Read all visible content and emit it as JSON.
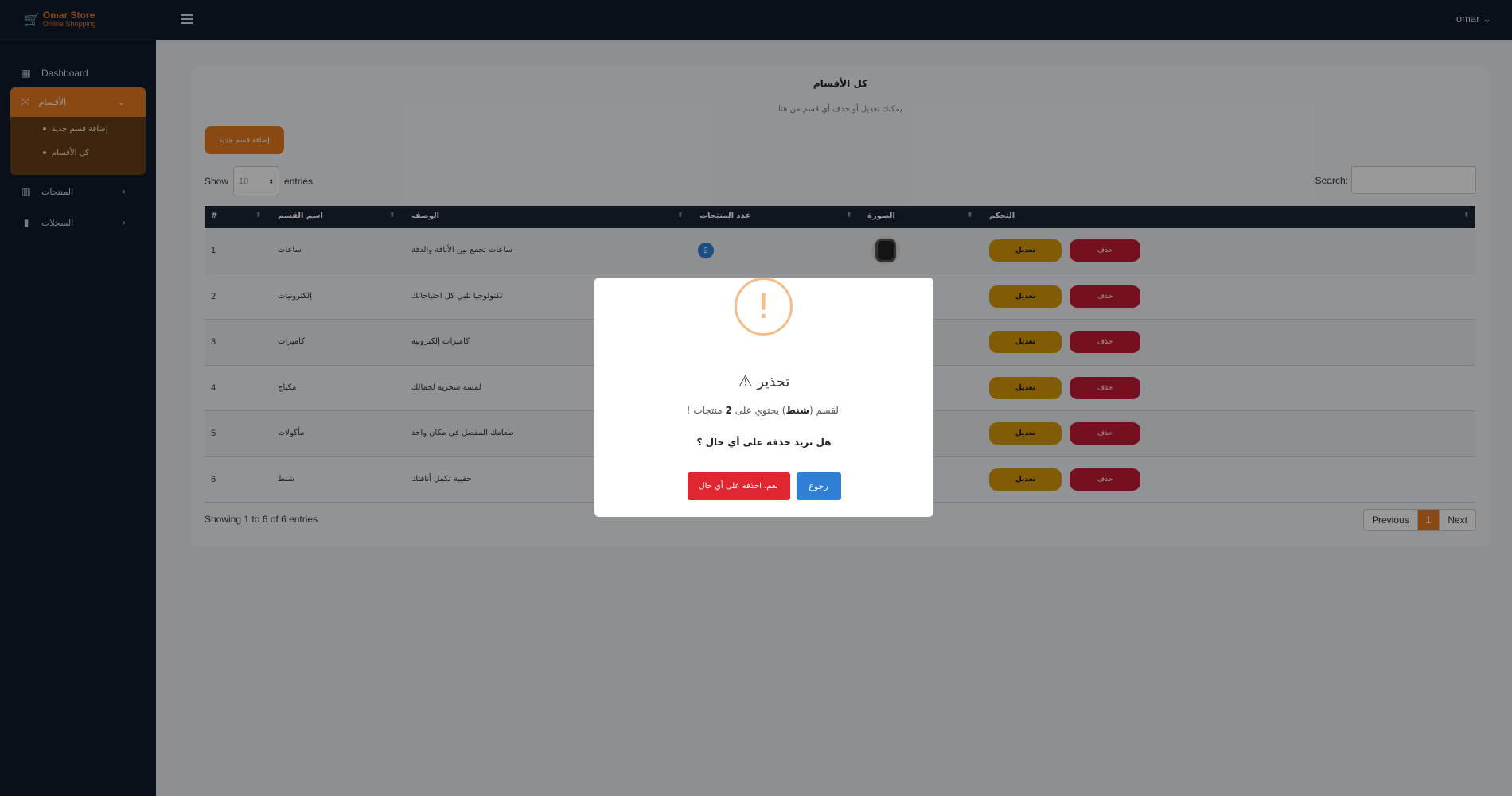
{
  "brand": {
    "name": "Omar Store",
    "tagline": "Online Shopping"
  },
  "topbar": {
    "user": "omar"
  },
  "sidebar": {
    "dashboard": "Dashboard",
    "categories": {
      "label": "الأقسام",
      "items": [
        {
          "label": "إضافة قسم جديد"
        },
        {
          "label": "كل الأقسام"
        }
      ]
    },
    "products": "المنتجات",
    "records": "السجلات"
  },
  "page": {
    "title": "كل الأقسام",
    "subtitle": "يمكنك تعديل أو حذف أي قسم من هنا",
    "add_button": "إضافة قسم جديد",
    "show_label": "Show",
    "entries_value": "10",
    "entries_label": "entries",
    "search_label": "Search:",
    "showing": "Showing 1 to 6 of 6 entries",
    "pagination": {
      "previous": "Previous",
      "current": "1",
      "next": "Next"
    }
  },
  "table": {
    "headers": {
      "num": "#",
      "name": "اسم القسم",
      "description": "الوصف",
      "count": "عدد المنتجات",
      "image": "الصورة",
      "control": "التحكم"
    },
    "edit_label": "تعديل",
    "delete_label": "حذف",
    "rows": [
      {
        "num": "1",
        "name": "ساعات",
        "description": "ساعات تجمع بين الأناقة والدقة",
        "count": "2"
      },
      {
        "num": "2",
        "name": "إلكترونيات",
        "description": "تكنولوجيا تلبي كل احتياجاتك"
      },
      {
        "num": "3",
        "name": "كاميرات",
        "description": "كاميرات إلكترونية"
      },
      {
        "num": "4",
        "name": "مكياج",
        "description": "لمسة سحرية لجمالك"
      },
      {
        "num": "5",
        "name": "مأكولات",
        "description": "طعامك المفضل في مكان واحد"
      },
      {
        "num": "6",
        "name": "شنط",
        "description": "حقيبة تكمل أناقتك"
      }
    ]
  },
  "modal": {
    "icon": "!",
    "title": "تحذير",
    "msg_prefix": "القسم (",
    "msg_category": "شنط",
    "msg_middle": ") يحتوي على ",
    "msg_count": "2",
    "msg_suffix": " منتجات !",
    "question": "هل تريد حذفه على أي حال ؟",
    "confirm": "نعم، احذفه على أي حال",
    "back": "رجوع"
  }
}
